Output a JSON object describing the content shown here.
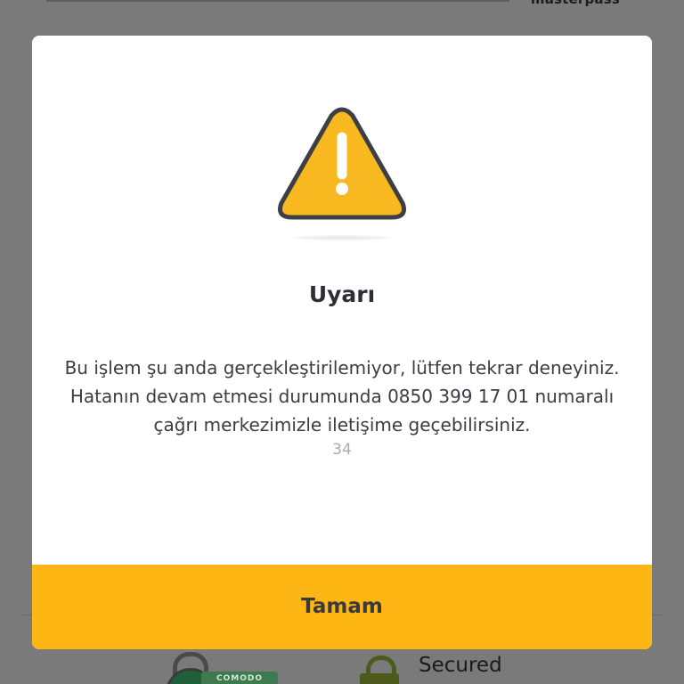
{
  "background": {
    "brand_text": "masterpass",
    "comodo_badge_text": "COMODO",
    "secured_label": "Secured"
  },
  "dialog": {
    "icon": "warning-triangle-icon",
    "title": "Uyarı",
    "message": "Bu işlem şu anda gerçekleştirilemiyor, lütfen tekrar deneyiniz. Hatanın devam etmesi durumunda 0850 399 17 01 numaralı çağrı merkezimizle iletişime geçebilirsiniz.",
    "error_code": "34",
    "ok_button_label": "Tamam"
  },
  "colors": {
    "accent": "#fdb614",
    "warning_fill": "#f8b820",
    "warning_stroke": "#3d3f44",
    "overlay": "#7a7a7a"
  }
}
